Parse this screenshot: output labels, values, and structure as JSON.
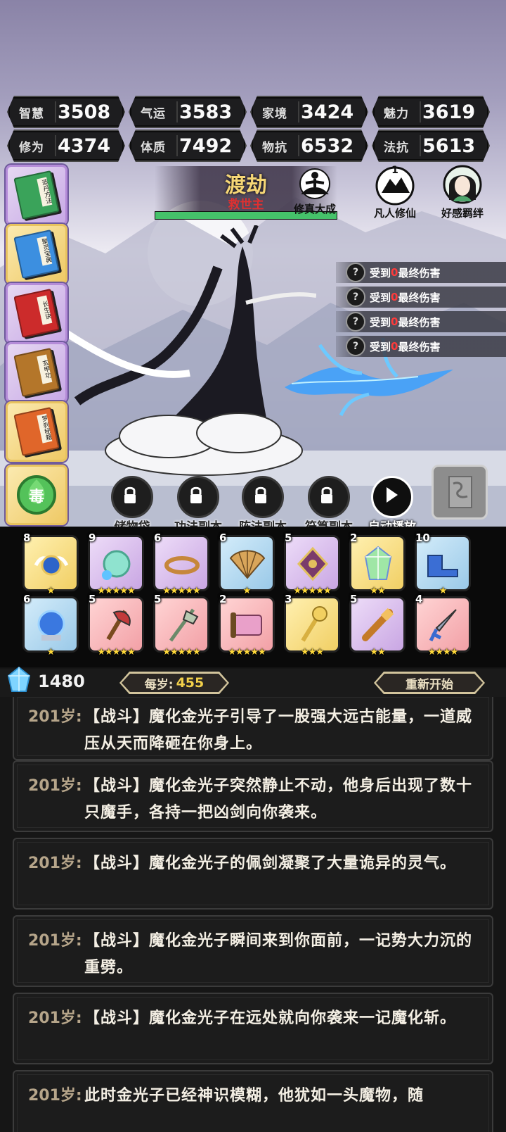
{
  "stats": [
    {
      "label": "智慧",
      "value": "3508"
    },
    {
      "label": "气运",
      "value": "3583"
    },
    {
      "label": "家境",
      "value": "3424"
    },
    {
      "label": "魅力",
      "value": "3619"
    },
    {
      "label": "修为",
      "value": "4374"
    },
    {
      "label": "体质",
      "value": "7492"
    },
    {
      "label": "物抗",
      "value": "6532"
    },
    {
      "label": "法抗",
      "value": "5613"
    }
  ],
  "stage": {
    "title": "渡劫",
    "subtitle": "救世主",
    "hp_fraction": 1.0
  },
  "badges": [
    {
      "label": "修真大成",
      "icon": "meditation-icon"
    },
    {
      "label": "凡人修仙",
      "icon": "cloud-mountain-icon"
    },
    {
      "label": "好感羁绊",
      "icon": "portrait-icon"
    }
  ],
  "books": [
    {
      "title": "造丹方法",
      "color": "#3aa35a",
      "frame": "purple"
    },
    {
      "title": "聚灵宝典",
      "color": "#3c8fe0",
      "frame": "gold"
    },
    {
      "title": "长生诀",
      "color": "#cc2b2b",
      "frame": "purple"
    },
    {
      "title": "玄甲功",
      "color": "#b4762a",
      "frame": "purple"
    },
    {
      "title": "罗刹秘籍",
      "color": "#e0662a",
      "frame": "gold"
    },
    {
      "title": "毒",
      "color": "#3fb34a",
      "frame": "gold"
    }
  ],
  "damage_feed": {
    "prefix": "受到",
    "value": "0",
    "suffix": "最终伤害",
    "rows": [
      "q1",
      "q2",
      "q3",
      "q4"
    ]
  },
  "actions": [
    {
      "label": "储物袋",
      "icon": "lock-icon"
    },
    {
      "label": "功法副本",
      "icon": "lock-icon"
    },
    {
      "label": "阵法副本",
      "icon": "lock-icon"
    },
    {
      "label": "符箓副本",
      "icon": "lock-icon"
    },
    {
      "label": "自动播放",
      "icon": "play-icon"
    }
  ],
  "items": [
    {
      "count": "8",
      "stars": "★",
      "frame": "gold",
      "icon": "winged-orb-icon"
    },
    {
      "count": "9",
      "stars": "★★★★★",
      "frame": "purple",
      "icon": "jade-pendant-icon"
    },
    {
      "count": "6",
      "stars": "★★★★★",
      "frame": "purple",
      "icon": "bronze-ring-icon"
    },
    {
      "count": "6",
      "stars": "★",
      "frame": "blue",
      "icon": "folding-fan-icon"
    },
    {
      "count": "5",
      "stars": "★★★★★",
      "frame": "purple",
      "icon": "amulet-icon"
    },
    {
      "count": "2",
      "stars": "★★",
      "frame": "gold",
      "icon": "crystal-icon"
    },
    {
      "count": "10",
      "stars": "★",
      "frame": "blue",
      "icon": "boots-icon"
    },
    {
      "count": "6",
      "stars": "★",
      "frame": "blue",
      "icon": "blue-orb-icon"
    },
    {
      "count": "5",
      "stars": "★★★★★",
      "frame": "red",
      "icon": "battle-axe-icon"
    },
    {
      "count": "5",
      "stars": "★★★★★",
      "frame": "red",
      "icon": "halberd-icon"
    },
    {
      "count": "2",
      "stars": "★★★★★",
      "frame": "red",
      "icon": "scroll-icon"
    },
    {
      "count": "3",
      "stars": "★★★",
      "frame": "gold",
      "icon": "golden-staff-icon"
    },
    {
      "count": "5",
      "stars": "★★",
      "frame": "purple",
      "icon": "telescope-icon"
    },
    {
      "count": "4",
      "stars": "★★★★",
      "frame": "red",
      "icon": "dagger-icon"
    }
  ],
  "currency": {
    "crystals": "1480",
    "per_year_label": "每岁:",
    "per_year_value": "455",
    "restart_label": "重新开始"
  },
  "log": [
    {
      "age": "201岁:",
      "text": "【战斗】魔化金光子引导了一股强大远古能量，一道威压从天而降砸在你身上。"
    },
    {
      "age": "201岁:",
      "text": "【战斗】魔化金光子突然静止不动，他身后出现了数十只魔手，各持一把凶剑向你袭来。"
    },
    {
      "age": "201岁:",
      "text": "【战斗】魔化金光子的佩剑凝聚了大量诡异的灵气。"
    },
    {
      "age": "201岁:",
      "text": "【战斗】魔化金光子瞬间来到你面前，一记势大力沉的重劈。"
    },
    {
      "age": "201岁:",
      "text": "【战斗】魔化金光子在远处就向你袭来一记魔化斩。"
    },
    {
      "age": "201岁:",
      "text": "此时金光子已经神识模糊，他犹如一头魔物，随"
    }
  ]
}
